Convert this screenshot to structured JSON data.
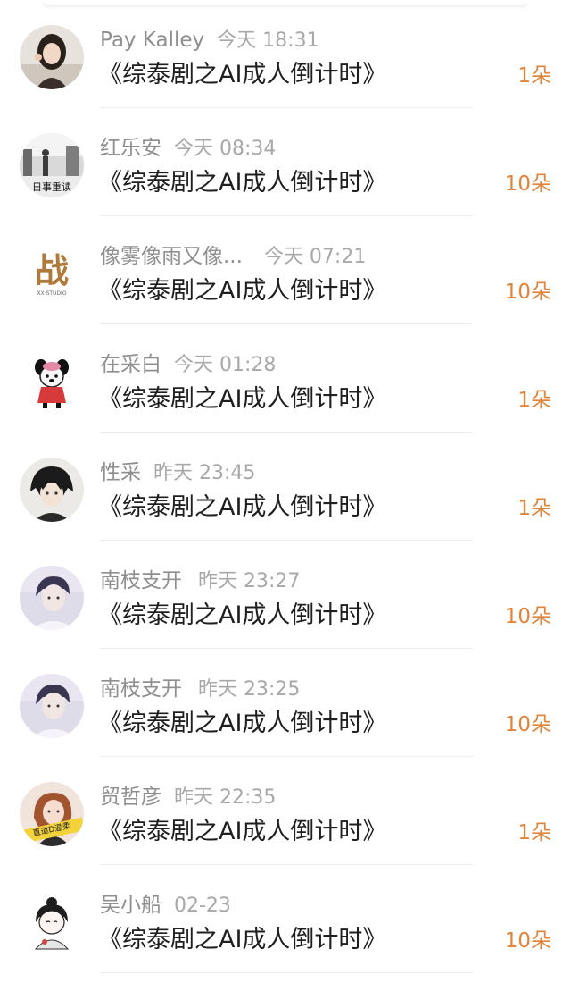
{
  "notifications": [
    {
      "name": "Pay Kalley",
      "time": "今天 18:31",
      "title": "《综泰剧之AI成人倒计时》",
      "count": "1朵",
      "avatar_icon": "girl-photo-icon"
    },
    {
      "name": "红乐安",
      "time": "今天 08:34",
      "title": "《综泰剧之AI成人倒计时》",
      "count": "10朵",
      "avatar_icon": "street-photo-icon",
      "avatar_caption": "日事重读"
    },
    {
      "name": "像雾像雨又像...",
      "time": "今天 07:21",
      "title": "《综泰剧之AI成人倒计时》",
      "count": "10朵",
      "avatar_icon": "calligraphy-logo-icon",
      "avatar_glyph": "战",
      "avatar_caption": "XX·STUDIO"
    },
    {
      "name": "在采白",
      "time": "今天 01:28",
      "title": "《综泰剧之AI成人倒计时》",
      "count": "1朵",
      "avatar_icon": "cartoon-dog-icon"
    },
    {
      "name": "性采",
      "time": "昨天 23:45",
      "title": "《综泰剧之AI成人倒计时》",
      "count": "1朵",
      "avatar_icon": "anime-boy-icon"
    },
    {
      "name": "南枝支开",
      "time": "昨天 23:27",
      "title": "《综泰剧之AI成人倒计时》",
      "count": "10朵",
      "avatar_icon": "man-portrait-icon"
    },
    {
      "name": "南枝支开",
      "time": "昨天 23:25",
      "title": "《综泰剧之AI成人倒计时》",
      "count": "10朵",
      "avatar_icon": "man-portrait-icon"
    },
    {
      "name": "贸哲彦",
      "time": "昨天 22:35",
      "title": "《综泰剧之AI成人倒计时》",
      "count": "1朵",
      "avatar_icon": "woman-portrait-icon",
      "avatar_caption": "直道D温柔"
    },
    {
      "name": "吴小船",
      "time": "02-23",
      "title": "《综泰剧之AI成人倒计时》",
      "count": "10朵",
      "avatar_icon": "cartoon-girl-icon"
    }
  ],
  "colors": {
    "accent_count": "#e0843a",
    "title_text": "#1f1f1f",
    "meta_text": "#9a9a9a",
    "divider": "#eeeeee"
  }
}
